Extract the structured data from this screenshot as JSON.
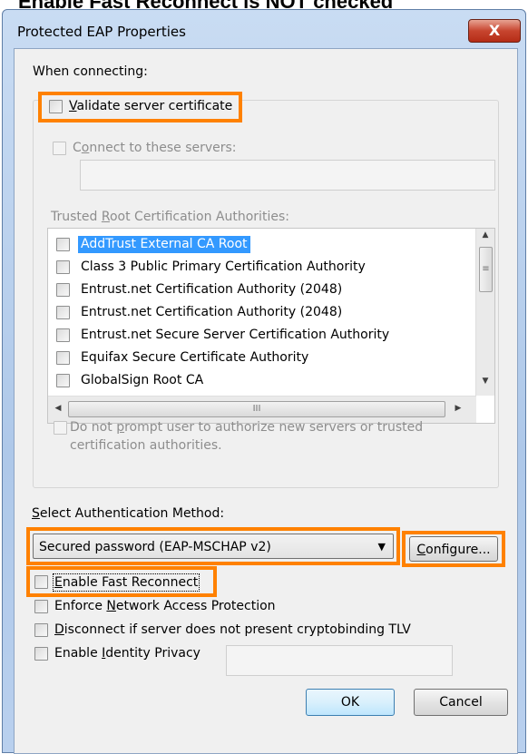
{
  "caption": "Enable Fast Reconnect is NOT checked",
  "window": {
    "title": "Protected EAP Properties",
    "close_glyph": "X"
  },
  "when_connecting": {
    "label": "When connecting:",
    "validate_cert": {
      "pre": "",
      "key": "V",
      "post": "alidate server certificate",
      "checked": false
    },
    "connect_servers": {
      "pre": "C",
      "key": "o",
      "post": "nnect to these servers:",
      "checked": false,
      "value": ""
    },
    "trusted_ca": {
      "pre": "Trusted ",
      "key": "R",
      "post": "oot Certification Authorities:"
    },
    "ca_list": [
      {
        "label": "AddTrust External CA Root",
        "checked": false,
        "selected": true
      },
      {
        "label": "Class 3 Public Primary Certification Authority",
        "checked": false,
        "selected": false
      },
      {
        "label": "Entrust.net Certification Authority (2048)",
        "checked": false,
        "selected": false
      },
      {
        "label": "Entrust.net Certification Authority (2048)",
        "checked": false,
        "selected": false
      },
      {
        "label": "Entrust.net Secure Server Certification Authority",
        "checked": false,
        "selected": false
      },
      {
        "label": "Equifax Secure Certificate Authority",
        "checked": false,
        "selected": false
      },
      {
        "label": "GlobalSign Root CA",
        "checked": false,
        "selected": false
      }
    ],
    "no_prompt": {
      "line1_pre": "Do not ",
      "key": "p",
      "line1_post": "rompt user to authorize new servers or trusted",
      "line2": "certification authorities.",
      "checked": false
    }
  },
  "auth": {
    "label_key": "S",
    "label_rest": "elect Authentication Method:",
    "method": "Secured password (EAP-MSCHAP v2)",
    "configure": {
      "key": "C",
      "rest": "onfigure..."
    }
  },
  "options": {
    "fast_reconnect": {
      "pre": "",
      "key": "E",
      "post": "nable Fast Reconnect",
      "checked": false
    },
    "nap": {
      "pre": "Enforce ",
      "key": "N",
      "post": "etwork Access Protection",
      "checked": false
    },
    "cryptobinding": {
      "pre": "",
      "key": "D",
      "post": "isconnect if server does not present cryptobinding TLV",
      "checked": false
    },
    "identity_privacy": {
      "pre": "Enable ",
      "key": "I",
      "post": "dentity Privacy",
      "checked": false,
      "value": ""
    }
  },
  "buttons": {
    "ok": "OK",
    "cancel": "Cancel"
  },
  "scroll_glyphs": {
    "up": "▲",
    "down": "▼",
    "left": "◀",
    "right": "▶",
    "grip": "≡",
    "grip_h": "III"
  },
  "colors": {
    "highlight": "#ff8100",
    "selection": "#3399ff"
  }
}
